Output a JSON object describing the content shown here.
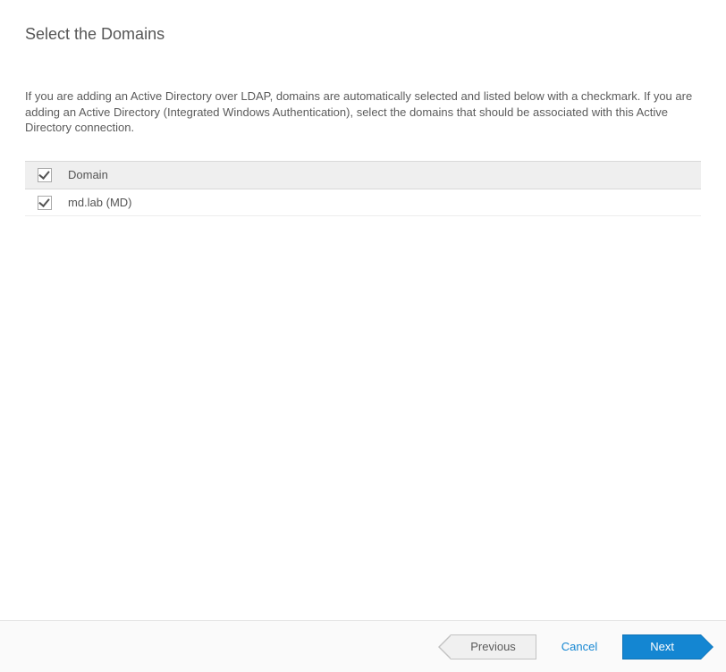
{
  "title": "Select the Domains",
  "description": "If you are adding an Active Directory over LDAP, domains are automatically selected and listed below with a checkmark. If you are adding an Active Directory (Integrated Windows Authentication), select the domains that should be associated with this Active Directory connection.",
  "table": {
    "select_all_checked": true,
    "header": "Domain",
    "rows": [
      {
        "checked": true,
        "label": "md.lab (MD)"
      }
    ]
  },
  "footer": {
    "previous": "Previous",
    "cancel": "Cancel",
    "next": "Next"
  }
}
